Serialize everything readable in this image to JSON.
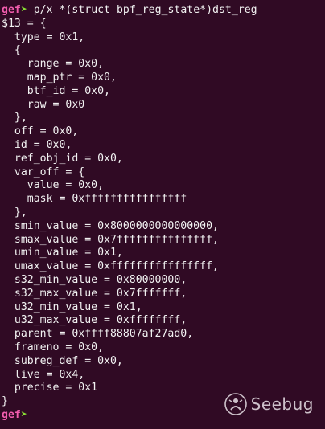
{
  "terminal": {
    "prompt": "gef",
    "prompt_arrow": "➤",
    "command": "p/x *(struct bpf_reg_state*)dst_reg",
    "output_lines": [
      "$13 = {",
      "  type = 0x1,",
      "  {",
      "    range = 0x0,",
      "    map_ptr = 0x0,",
      "    btf_id = 0x0,",
      "    raw = 0x0",
      "  },",
      "  off = 0x0,",
      "  id = 0x0,",
      "  ref_obj_id = 0x0,",
      "  var_off = {",
      "    value = 0x0,",
      "    mask = 0xffffffffffffffff",
      "  },",
      "  smin_value = 0x8000000000000000,",
      "  smax_value = 0x7fffffffffffffff,",
      "  umin_value = 0x1,",
      "  umax_value = 0xffffffffffffffff,",
      "  s32_min_value = 0x80000000,",
      "  s32_max_value = 0x7fffffff,",
      "  u32_min_value = 0x1,",
      "  u32_max_value = 0xffffffff,",
      "  parent = 0xffff88807af27ad0,",
      "  frameno = 0x0,",
      "  subreg_def = 0x0,",
      "  live = 0x4,",
      "  precise = 0x1",
      "}"
    ]
  },
  "watermark": {
    "text": "Seebug",
    "icon": "seebug-logo-icon"
  },
  "colors": {
    "background": "#300a24",
    "prompt_label": "#f25dae",
    "prompt_arrow": "#8ae234",
    "text": "#f2f2f2"
  }
}
